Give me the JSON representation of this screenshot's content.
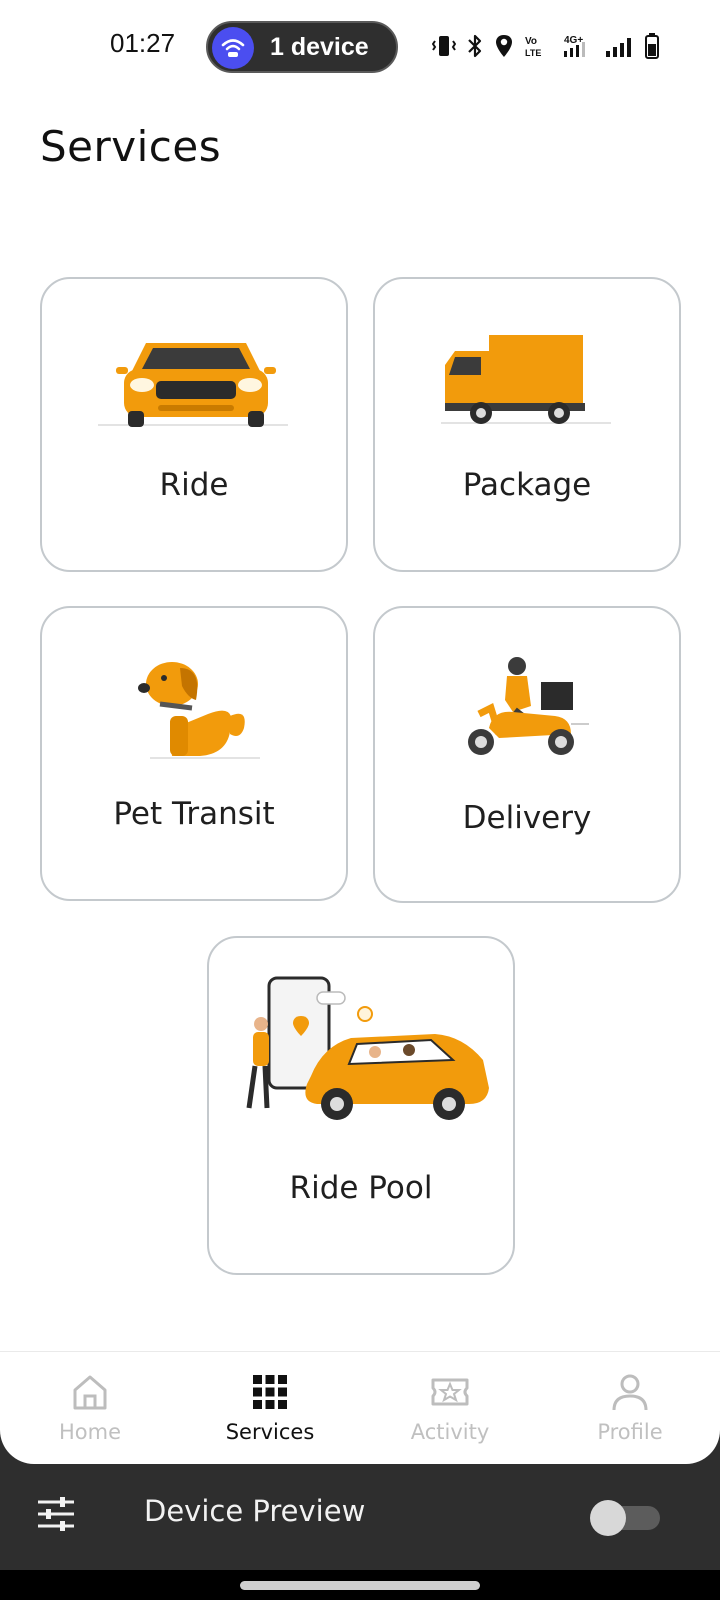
{
  "status_bar": {
    "time": "01:27",
    "device_pill": "1 device",
    "icons": [
      "vibrate-icon",
      "bluetooth-icon",
      "location-icon",
      "volte-icon",
      "4g-signal-icon",
      "signal-icon",
      "battery-icon"
    ],
    "volte_text": "Vo)) LTE2",
    "network_text": "4G+"
  },
  "page": {
    "title": "Services"
  },
  "services": [
    {
      "id": "ride",
      "label": "Ride",
      "icon": "car-icon"
    },
    {
      "id": "package",
      "label": "Package",
      "icon": "truck-icon"
    },
    {
      "id": "pet",
      "label": "Pet Transit",
      "icon": "dog-icon"
    },
    {
      "id": "delivery",
      "label": "Delivery",
      "icon": "scooter-icon"
    },
    {
      "id": "pool",
      "label": "Ride Pool",
      "icon": "carpool-icon"
    }
  ],
  "bottom_nav": {
    "active": "Services",
    "items": [
      {
        "label": "Home",
        "icon": "home-icon"
      },
      {
        "label": "Services",
        "icon": "grid-icon"
      },
      {
        "label": "Activity",
        "icon": "ticket-star-icon"
      },
      {
        "label": "Profile",
        "icon": "person-icon"
      }
    ]
  },
  "device_preview": {
    "label": "Device Preview",
    "enabled": false
  },
  "colors": {
    "accent_orange": "#f29b0c",
    "card_border": "#c4c9cd",
    "preview_bar": "#2e2e2e",
    "pill_badge": "#4b4ef0"
  }
}
